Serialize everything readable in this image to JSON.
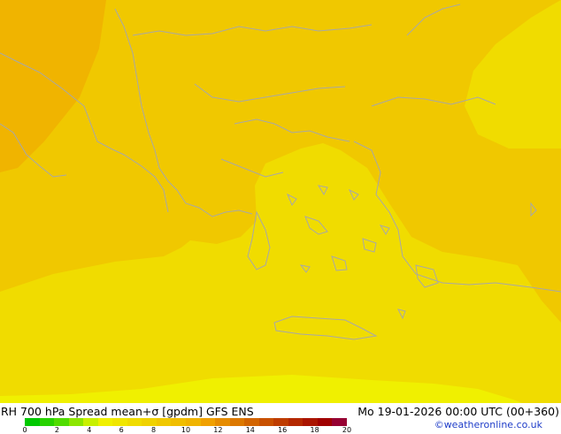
{
  "map": {
    "colors": {
      "deep_orange": "#f0b400",
      "orange": "#f0c800",
      "gold": "#f0dc00",
      "yellow": "#f0f000",
      "coast": "#a8a8a8"
    }
  },
  "footer": {
    "left_caption": "RH 700 hPa Spread mean+σ [gpdm] GFS ENS",
    "right_caption": "Mo 19-01-2026 00:00 UTC (00+360)",
    "credit": "©weatheronline.co.uk"
  },
  "legend": {
    "ticks": [
      "0",
      "2",
      "4",
      "6",
      "8",
      "10",
      "12",
      "14",
      "16",
      "18",
      "20"
    ],
    "colors": [
      "#00c800",
      "#28d200",
      "#50dc00",
      "#8ce600",
      "#c8f000",
      "#f0f000",
      "#f0e600",
      "#f0dc00",
      "#f0d200",
      "#f0c800",
      "#f0be00",
      "#f0b400",
      "#f0a000",
      "#e68c00",
      "#dc7800",
      "#d26400",
      "#c85000",
      "#be3c00",
      "#b42800",
      "#aa1400",
      "#a00000",
      "#960032"
    ]
  }
}
